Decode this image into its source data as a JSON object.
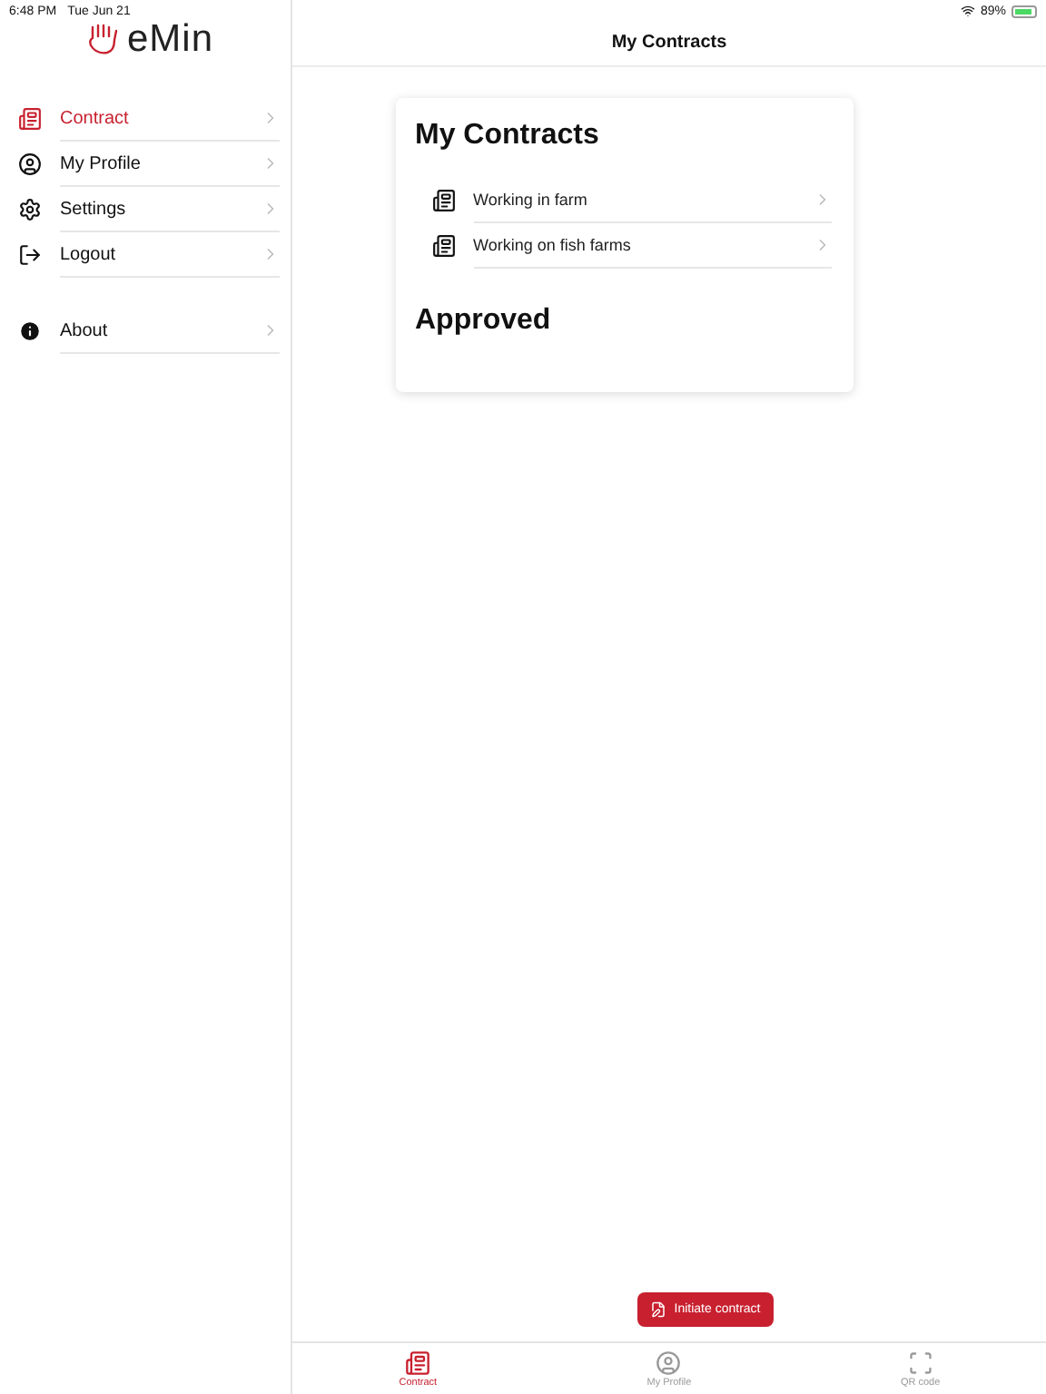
{
  "status_bar": {
    "time": "6:48 PM",
    "date": "Tue Jun 21",
    "battery": "89%"
  },
  "logo": {
    "text": "eMin"
  },
  "sidebar": {
    "items": [
      {
        "label": "Contract",
        "kind": "contract",
        "selected": true
      },
      {
        "label": "My Profile",
        "kind": "profile",
        "selected": false
      },
      {
        "label": "Settings",
        "kind": "settings",
        "selected": false
      },
      {
        "label": "Logout",
        "kind": "logout",
        "selected": false
      }
    ],
    "extra_items": [
      {
        "label": "About",
        "kind": "about",
        "selected": false
      }
    ]
  },
  "header": {
    "title": "My Contracts"
  },
  "card": {
    "title": "My Contracts",
    "contracts": [
      "Working in farm",
      "Working on fish farms"
    ],
    "section": "Approved"
  },
  "action_button": {
    "label": "Initiate contract"
  },
  "tab_bar": [
    {
      "label": "Contract",
      "kind": "contract",
      "selected": true
    },
    {
      "label": "My Profile",
      "kind": "profile",
      "selected": false
    },
    {
      "label": "QR code",
      "kind": "qr",
      "selected": false
    }
  ]
}
